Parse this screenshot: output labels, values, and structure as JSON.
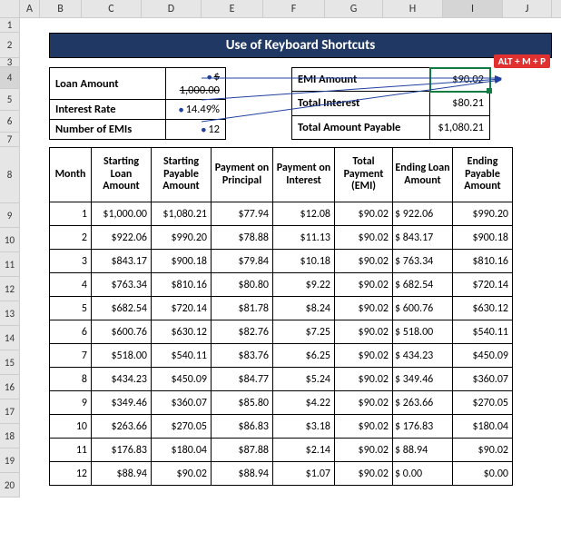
{
  "title": "Use of Keyboard Shortcuts",
  "key_hint": "ALT + M + P",
  "column_letters": [
    "A",
    "B",
    "C",
    "D",
    "E",
    "F",
    "G",
    "H",
    "I",
    "J"
  ],
  "row_numbers": [
    "1",
    "2",
    "3",
    "4",
    "5",
    "6",
    "7",
    "8",
    "9",
    "10",
    "11",
    "12",
    "13",
    "14",
    "15",
    "16",
    "17",
    "18",
    "19",
    "20"
  ],
  "summary_left": {
    "loan_amount_label": "Loan Amount",
    "loan_amount_value": "$ 1,000.00",
    "interest_rate_label": "Interest Rate",
    "interest_rate_value": "14.49%",
    "num_emi_label": "Number of EMIs",
    "num_emi_value": "12"
  },
  "summary_right": {
    "emi_amount_label": "EMI Amount",
    "emi_amount_value": "$90.02",
    "total_interest_label": "Total Interest",
    "total_interest_value": "$80.21",
    "total_payable_label": "Total Amount Payable",
    "total_payable_value": "$1,080.21"
  },
  "schedule_headers": {
    "month": "Month",
    "start_loan": "Starting Loan Amount",
    "start_payable": "Starting Payable Amount",
    "pay_principal": "Payment on Principal",
    "pay_interest": "Payment on Interest",
    "total_payment": "Total Payment (EMI)",
    "end_loan": "Ending Loan Amount",
    "end_payable": "Ending Payable Amount"
  },
  "chart_data": {
    "type": "table",
    "columns": [
      "Month",
      "Starting Loan Amount",
      "Starting Payable Amount",
      "Payment on Principal",
      "Payment on Interest",
      "Total Payment (EMI)",
      "Ending Loan Amount",
      "Ending Payable Amount"
    ],
    "rows": [
      [
        "1",
        "$1,000.00",
        "$1,080.21",
        "$77.94",
        "$12.08",
        "$90.02",
        "$ 922.06",
        "$990.20"
      ],
      [
        "2",
        "$922.06",
        "$990.20",
        "$78.88",
        "$11.13",
        "$90.02",
        "$ 843.17",
        "$900.18"
      ],
      [
        "3",
        "$843.17",
        "$900.18",
        "$79.84",
        "$10.18",
        "$90.02",
        "$ 763.34",
        "$810.16"
      ],
      [
        "4",
        "$763.34",
        "$810.16",
        "$80.80",
        "$9.22",
        "$90.02",
        "$ 682.54",
        "$720.14"
      ],
      [
        "5",
        "$682.54",
        "$720.14",
        "$81.78",
        "$8.24",
        "$90.02",
        "$ 600.76",
        "$630.12"
      ],
      [
        "6",
        "$600.76",
        "$630.12",
        "$82.76",
        "$7.25",
        "$90.02",
        "$ 518.00",
        "$540.11"
      ],
      [
        "7",
        "$518.00",
        "$540.11",
        "$83.76",
        "$6.25",
        "$90.02",
        "$ 434.23",
        "$450.09"
      ],
      [
        "8",
        "$434.23",
        "$450.09",
        "$84.77",
        "$5.24",
        "$90.02",
        "$ 349.46",
        "$360.07"
      ],
      [
        "9",
        "$349.46",
        "$360.07",
        "$85.80",
        "$4.22",
        "$90.02",
        "$ 263.66",
        "$270.05"
      ],
      [
        "10",
        "$263.66",
        "$270.05",
        "$86.83",
        "$3.18",
        "$90.02",
        "$ 176.83",
        "$180.04"
      ],
      [
        "11",
        "$176.83",
        "$180.04",
        "$87.88",
        "$2.14",
        "$90.02",
        "$   88.94",
        "$90.02"
      ],
      [
        "12",
        "$88.94",
        "$90.02",
        "$88.94",
        "$1.07",
        "$90.02",
        "$     0.00",
        "$0.00"
      ]
    ]
  }
}
